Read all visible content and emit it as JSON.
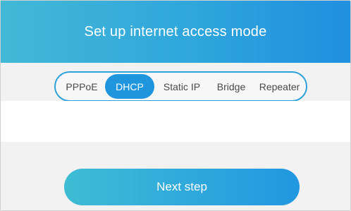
{
  "header": {
    "title": "Set up internet access mode"
  },
  "modes": {
    "options": [
      "PPPoE",
      "DHCP",
      "Static IP",
      "Bridge",
      "Repeater"
    ],
    "selected": "DHCP"
  },
  "actions": {
    "next_label": "Next step"
  },
  "colors": {
    "accent": "#1f95de",
    "header_start": "#43b8d6",
    "header_end": "#1f8fdf",
    "background": "#f2f2f2"
  }
}
